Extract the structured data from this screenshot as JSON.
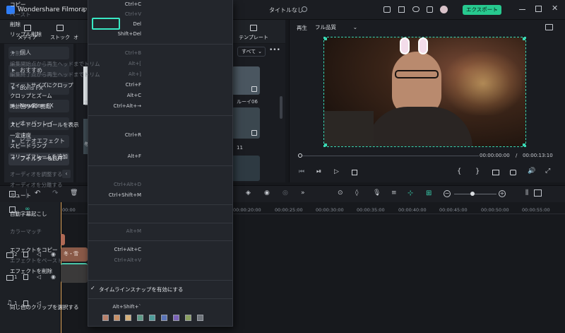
{
  "app": {
    "name": "Wondershare Filmora",
    "doc_title": "タイトルなし",
    "menu_partial": "フ"
  },
  "titlebar": {
    "export_label": "エクスポート"
  },
  "toolbar": {
    "media": "メディア",
    "stock": "ストック",
    "partial": "オ",
    "template": "テンプレート"
  },
  "sidebar": {
    "items": [
      "個人",
      "おすすめ",
      "Boris FX",
      "NewBlue FX",
      "オーバーレイ",
      "ビデオエフェクト",
      "フィルター&LUT"
    ]
  },
  "library": {
    "filter_label": "すべて",
    "thumb_text_1": "ルーイ06",
    "thumb_text_2": "11",
    "thumb_text_3": "冬",
    "thumb_text_4": "雪"
  },
  "preview": {
    "mode_label": "再生",
    "quality": "フル品質",
    "current_time": "00:00:00:00",
    "separator": "/",
    "total_time": "00:00:13:10"
  },
  "timeline": {
    "ruler": [
      "00:00",
      "00:00:20:00",
      "00:00:25:00",
      "00:00:30:00",
      "00:00:35:00",
      "00:00:40:00",
      "00:00:45:00",
      "00:00:50:00",
      "00:00:55:00"
    ],
    "tracks": [
      {
        "num": "2"
      },
      {
        "num": "1"
      },
      {
        "num": "1"
      }
    ],
    "clip_label": "冬・雪"
  },
  "context_menu": {
    "items": [
      {
        "label": "コピー",
        "shortcut": "Ctrl+C",
        "disabled": false
      },
      {
        "label": "ペースト",
        "shortcut": "Ctrl+V",
        "disabled": true
      },
      {
        "label": "削除",
        "shortcut": "Del",
        "disabled": false,
        "highlight": true
      },
      {
        "label": "リップル削除",
        "shortcut": "Shift+Del",
        "disabled": false
      },
      {
        "label": "分割",
        "shortcut": "Ctrl+B",
        "disabled": true
      },
      {
        "label": "編集開始点から再生ヘッドまでトリム",
        "shortcut": "Alt+[",
        "disabled": true
      },
      {
        "label": "編集終了点から再生ヘッドまでトリム",
        "shortcut": "Alt+]",
        "disabled": true
      },
      {
        "label": "フィットサイズにクロップ",
        "shortcut": "Ctrl+F",
        "disabled": false
      },
      {
        "label": "クロップとズーム",
        "shortcut": "Alt+C",
        "disabled": false
      },
      {
        "label": "時計回り90°回転",
        "shortcut": "Ctrl+Alt+→",
        "disabled": false
      },
      {
        "label": "スピードコントロールを表示",
        "shortcut": "",
        "disabled": false
      },
      {
        "label": "一定速度",
        "shortcut": "Ctrl+R",
        "disabled": false
      },
      {
        "label": "スピードランプ",
        "shortcut": "",
        "disabled": false
      },
      {
        "label": "フリーズフレームを追加",
        "shortcut": "Alt+F",
        "disabled": false
      },
      {
        "label": "オーディオを調整する",
        "shortcut": "",
        "disabled": true
      },
      {
        "label": "オーディオを分離する",
        "shortcut": "Ctrl+Alt+D",
        "disabled": true
      },
      {
        "label": "ミュート",
        "shortcut": "Ctrl+Shift+M",
        "disabled": false
      },
      {
        "label": "自動字幕起こし",
        "shortcut": "",
        "disabled": false
      },
      {
        "label": "カラーマッチ",
        "shortcut": "Alt+M",
        "disabled": true
      },
      {
        "label": "エフェクトをコピー",
        "shortcut": "Ctrl+Alt+C",
        "disabled": false
      },
      {
        "label": "エフェクトをペースト",
        "shortcut": "Ctrl+Alt+V",
        "disabled": true
      },
      {
        "label": "エフェクトを削除",
        "shortcut": "",
        "disabled": false
      },
      {
        "label": "タイムラインスナップを有効にする",
        "shortcut": "",
        "disabled": false,
        "checked": true
      },
      {
        "label": "同じ色のクリップを選択する",
        "shortcut": "Alt+Shift+`",
        "disabled": false
      }
    ],
    "color_swatches": [
      "#b9806a",
      "#c99066",
      "#d6b07a",
      "#5e9a86",
      "#4f9c9a",
      "#5a74b8",
      "#7a62b8",
      "#8aa060",
      "#70757c"
    ]
  },
  "colors": {
    "accent": "#39d6b3",
    "export_bg": "#27c98f",
    "highlight_box": "#39e8c4"
  }
}
